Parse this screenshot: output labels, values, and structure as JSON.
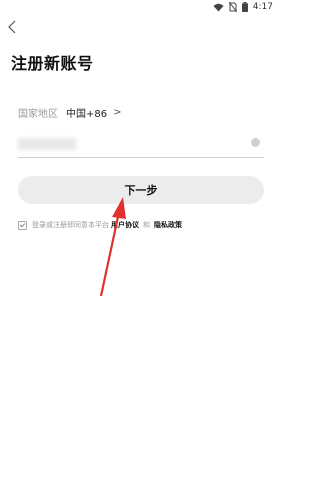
{
  "status": {
    "time": "4:17"
  },
  "page": {
    "title": "注册新账号"
  },
  "region": {
    "label": "国家地区",
    "value": "中国+86",
    "chevron": ">"
  },
  "phone": {
    "value": "",
    "placeholder": ""
  },
  "next": {
    "label": "下一步"
  },
  "agreement": {
    "text": "登录或注册即同意本平台",
    "user_agreement": "用户协议",
    "and": "和",
    "privacy_policy": "隐私政策",
    "checked": true
  },
  "colors": {
    "button_bg": "#ececec",
    "arrow": "#e03131"
  },
  "icons": [
    "wifi-icon",
    "no-sim-icon",
    "battery-icon",
    "back-arrow-icon",
    "clear-icon",
    "check-icon"
  ]
}
